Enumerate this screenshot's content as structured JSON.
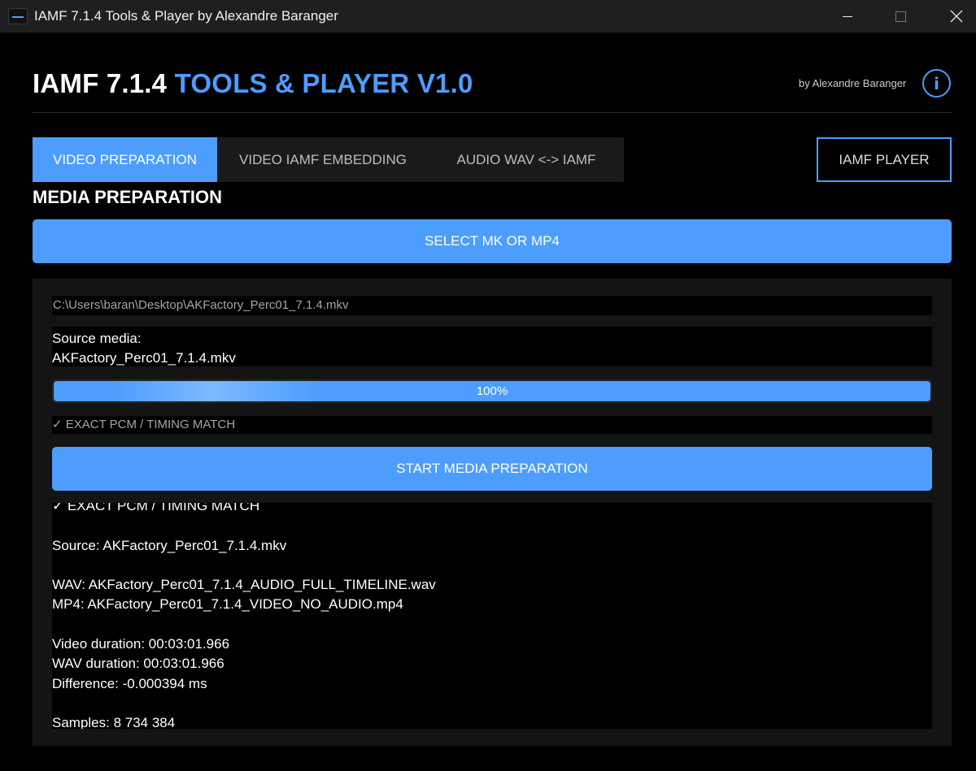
{
  "window": {
    "title": "IAMF 7.1.4 Tools & Player by Alexandre Baranger",
    "controls": [
      "minimize",
      "maximize",
      "close"
    ]
  },
  "header": {
    "title_part1": "IAMF 7.1.4 ",
    "title_part2": "TOOLS & PLAYER V1.0",
    "byline": "by Alexandre Baranger",
    "info_label": "i"
  },
  "tabs": [
    {
      "label": "VIDEO PREPARATION",
      "active": true
    },
    {
      "label": "VIDEO IAMF EMBEDDING",
      "active": false
    },
    {
      "label": "AUDIO WAV <-> IAMF",
      "active": false
    }
  ],
  "player_button": "IAMF PLAYER",
  "section": {
    "title": "MEDIA PREPARATION",
    "select_button": "SELECT MK OR MP4"
  },
  "panel": {
    "file_path": "C:\\Users\\baran\\Desktop\\AKFactory_Perc01_7.1.4.mkv",
    "source_label": "Source media:",
    "source_file": "AKFactory_Perc01_7.1.4.mkv",
    "progress_value": 100,
    "progress_text": "100%",
    "status_text": "✓ EXACT PCM / TIMING MATCH",
    "start_button": "START MEDIA PREPARATION",
    "log_lines": [
      "✓ EXACT PCM / TIMING MATCH",
      "",
      "Source: AKFactory_Perc01_7.1.4.mkv",
      "",
      "WAV: AKFactory_Perc01_7.1.4_AUDIO_FULL_TIMELINE.wav",
      "MP4: AKFactory_Perc01_7.1.4_VIDEO_NO_AUDIO.mp4",
      "",
      "Video duration: 00:03:01.966",
      "WAV duration: 00:03:01.966",
      "Difference: -0.000394 ms",
      "",
      "Samples: 8 734 384"
    ]
  },
  "colors": {
    "accent": "#4d9dff",
    "background": "#000000",
    "panel": "#141414",
    "titlebar": "#1f1f1f",
    "muted_text": "#a6a6a6"
  }
}
